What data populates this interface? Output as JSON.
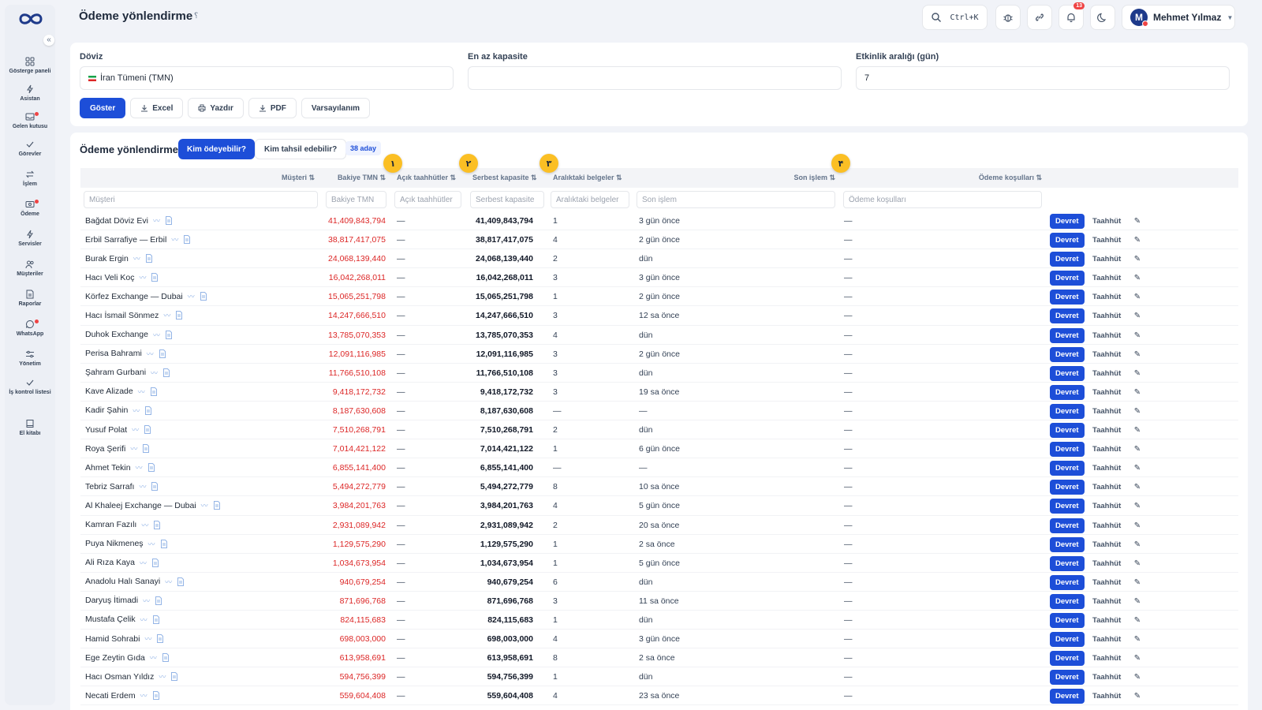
{
  "app": {
    "page_title": "Ödeme yönlendirme",
    "title_help": "؟"
  },
  "sidebar": {
    "items": [
      {
        "label": "Gösterge paneli",
        "icon": "dashboard-icon",
        "dot": false
      },
      {
        "label": "Asistan",
        "icon": "bolt-icon",
        "dot": false
      },
      {
        "label": "Gelen kutusu",
        "icon": "inbox-icon",
        "dot": true
      },
      {
        "label": "Görevler",
        "icon": "check-icon",
        "dot": false
      },
      {
        "label": "İşlem",
        "icon": "swap-icon",
        "dot": false
      },
      {
        "label": "Ödeme",
        "icon": "payment-icon",
        "dot": true
      },
      {
        "label": "Servisler",
        "icon": "bolt-icon",
        "dot": false
      },
      {
        "label": "Müşteriler",
        "icon": "users-icon",
        "dot": false
      },
      {
        "label": "Raporlar",
        "icon": "report-icon",
        "dot": false
      },
      {
        "label": "WhatsApp",
        "icon": "chat-icon",
        "dot": true
      },
      {
        "label": "Yönetim",
        "icon": "sliders-icon",
        "dot": false
      },
      {
        "label": "İş kontrol listesi",
        "icon": "check-icon",
        "dot": false
      },
      {
        "label": "El kitabı",
        "icon": "book-icon",
        "dot": false
      }
    ]
  },
  "header": {
    "search_shortcut": "Ctrl+K",
    "notification_count": "13",
    "user_initial": "M",
    "user_name": "Mehmet Yılmaz"
  },
  "filters": {
    "currency_label": "Döviz",
    "currency_value": "İran Tümeni (TMN)",
    "min_capacity_label": "En az kapasite",
    "min_capacity_value": "",
    "activity_label": "Etkinlik aralığı (gün)",
    "activity_value": "7",
    "show_label": "Göster",
    "excel_label": "Excel",
    "print_label": "Yazdır",
    "pdf_label": "PDF",
    "default_label": "Varsayılanım"
  },
  "section": {
    "title": "Ödeme yönlendirme",
    "tab_pay": "Kim ödeyebilir?",
    "tab_collect": "Kim tahsil edebilir?",
    "candidates": "38 aday"
  },
  "table": {
    "headers": {
      "customer": "Müşteri ⇅",
      "balance": "Bakiye TMN ⇅",
      "open": "Açık taahhütler ⇅",
      "free": "Serbest kapasite ⇅",
      "docs": "Aralıktaki belgeler ⇅",
      "last": "Son işlem ⇅",
      "terms": "Ödeme koşulları ⇅"
    },
    "filters": {
      "customer": "Müşteri",
      "balance": "Bakiye TMN",
      "open": "Açık taahhütler",
      "free": "Serbest kapasite",
      "docs": "Aralıktaki belgeler",
      "last": "Son işlem",
      "terms": "Ödeme koşulları"
    },
    "steps": [
      "١",
      "٢",
      "٣",
      "۴"
    ],
    "action_transfer": "Devret",
    "action_commit": "Taahhüt",
    "action_edit": "✎",
    "rows": [
      {
        "name": "Bağdat Döviz Evi",
        "balance": "41,409,843,794",
        "open": "—",
        "free": "41,409,843,794",
        "docs": "1",
        "last": "3 gün önce",
        "terms": "—"
      },
      {
        "name": "Erbil Sarrafiye — Erbil",
        "balance": "38,817,417,075",
        "open": "—",
        "free": "38,817,417,075",
        "docs": "4",
        "last": "2 gün önce",
        "terms": "—"
      },
      {
        "name": "Burak Ergin",
        "balance": "24,068,139,440",
        "open": "—",
        "free": "24,068,139,440",
        "docs": "2",
        "last": "dün",
        "terms": "—"
      },
      {
        "name": "Hacı Veli Koç",
        "balance": "16,042,268,011",
        "open": "—",
        "free": "16,042,268,011",
        "docs": "3",
        "last": "3 gün önce",
        "terms": "—"
      },
      {
        "name": "Körfez Exchange — Dubai",
        "balance": "15,065,251,798",
        "open": "—",
        "free": "15,065,251,798",
        "docs": "1",
        "last": "2 gün önce",
        "terms": "—"
      },
      {
        "name": "Hacı İsmail Sönmez",
        "balance": "14,247,666,510",
        "open": "—",
        "free": "14,247,666,510",
        "docs": "3",
        "last": "12 sa önce",
        "terms": "—"
      },
      {
        "name": "Duhok Exchange",
        "balance": "13,785,070,353",
        "open": "—",
        "free": "13,785,070,353",
        "docs": "4",
        "last": "dün",
        "terms": "—"
      },
      {
        "name": "Perisa Bahrami",
        "balance": "12,091,116,985",
        "open": "—",
        "free": "12,091,116,985",
        "docs": "3",
        "last": "2 gün önce",
        "terms": "—"
      },
      {
        "name": "Şahram Gurbani",
        "balance": "11,766,510,108",
        "open": "—",
        "free": "11,766,510,108",
        "docs": "3",
        "last": "dün",
        "terms": "—"
      },
      {
        "name": "Kave Alizade",
        "balance": "9,418,172,732",
        "open": "—",
        "free": "9,418,172,732",
        "docs": "3",
        "last": "19 sa önce",
        "terms": "—"
      },
      {
        "name": "Kadir Şahin",
        "balance": "8,187,630,608",
        "open": "—",
        "free": "8,187,630,608",
        "docs": "—",
        "last": "—",
        "terms": "—"
      },
      {
        "name": "Yusuf Polat",
        "balance": "7,510,268,791",
        "open": "—",
        "free": "7,510,268,791",
        "docs": "2",
        "last": "dün",
        "terms": "—"
      },
      {
        "name": "Roya Şerifi",
        "balance": "7,014,421,122",
        "open": "—",
        "free": "7,014,421,122",
        "docs": "1",
        "last": "6 gün önce",
        "terms": "—"
      },
      {
        "name": "Ahmet Tekin",
        "balance": "6,855,141,400",
        "open": "—",
        "free": "6,855,141,400",
        "docs": "—",
        "last": "—",
        "terms": "—"
      },
      {
        "name": "Tebriz Sarrafı",
        "balance": "5,494,272,779",
        "open": "—",
        "free": "5,494,272,779",
        "docs": "8",
        "last": "10 sa önce",
        "terms": "—"
      },
      {
        "name": "Al Khaleej Exchange — Dubai",
        "balance": "3,984,201,763",
        "open": "—",
        "free": "3,984,201,763",
        "docs": "4",
        "last": "5 gün önce",
        "terms": "—"
      },
      {
        "name": "Kamran Fazılı",
        "balance": "2,931,089,942",
        "open": "—",
        "free": "2,931,089,942",
        "docs": "2",
        "last": "20 sa önce",
        "terms": "—"
      },
      {
        "name": "Puya Nikmeneş",
        "balance": "1,129,575,290",
        "open": "—",
        "free": "1,129,575,290",
        "docs": "1",
        "last": "2 sa önce",
        "terms": "—"
      },
      {
        "name": "Ali Rıza Kaya",
        "balance": "1,034,673,954",
        "open": "—",
        "free": "1,034,673,954",
        "docs": "1",
        "last": "5 gün önce",
        "terms": "—"
      },
      {
        "name": "Anadolu Halı Sanayi",
        "balance": "940,679,254",
        "open": "—",
        "free": "940,679,254",
        "docs": "6",
        "last": "dün",
        "terms": "—"
      },
      {
        "name": "Daryuş İtimadi",
        "balance": "871,696,768",
        "open": "—",
        "free": "871,696,768",
        "docs": "3",
        "last": "11 sa önce",
        "terms": "—"
      },
      {
        "name": "Mustafa Çelik",
        "balance": "824,115,683",
        "open": "—",
        "free": "824,115,683",
        "docs": "1",
        "last": "dün",
        "terms": "—"
      },
      {
        "name": "Hamid Sohrabi",
        "balance": "698,003,000",
        "open": "—",
        "free": "698,003,000",
        "docs": "4",
        "last": "3 gün önce",
        "terms": "—"
      },
      {
        "name": "Ege Zeytin Gıda",
        "balance": "613,958,691",
        "open": "—",
        "free": "613,958,691",
        "docs": "8",
        "last": "2 sa önce",
        "terms": "—"
      },
      {
        "name": "Hacı Osman Yıldız",
        "balance": "594,756,399",
        "open": "—",
        "free": "594,756,399",
        "docs": "1",
        "last": "dün",
        "terms": "—"
      },
      {
        "name": "Necati Erdem",
        "balance": "559,604,408",
        "open": "—",
        "free": "559,604,408",
        "docs": "4",
        "last": "23 sa önce",
        "terms": "—"
      }
    ]
  }
}
